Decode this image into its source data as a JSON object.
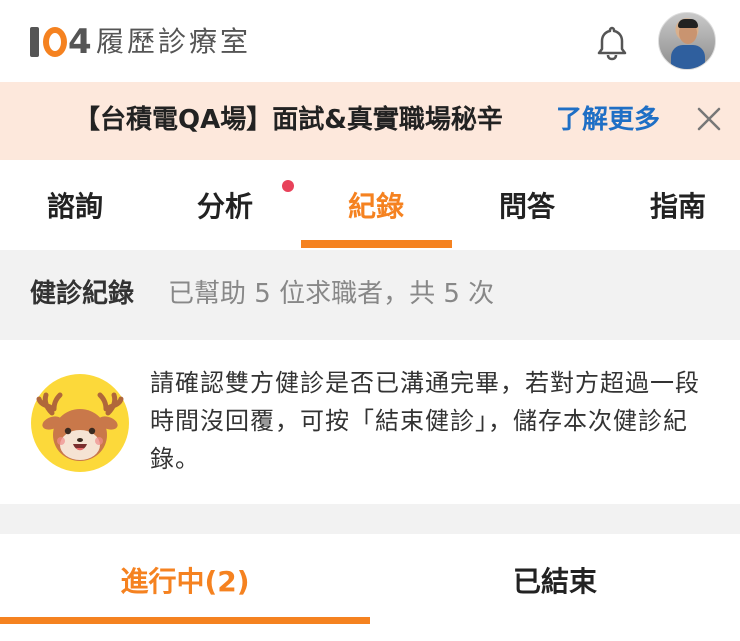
{
  "header": {
    "logo_text": "履歷診療室",
    "logo_mark": "104",
    "bell_icon": "bell-icon",
    "avatar_icon": "user-avatar"
  },
  "banner": {
    "text": "【台積電QA場】面試&真實職場秘辛",
    "link": "了解更多",
    "close_icon": "close-icon"
  },
  "tabs": [
    {
      "label": "諮詢"
    },
    {
      "label": "分析"
    },
    {
      "label": "紀錄"
    },
    {
      "label": "問答"
    },
    {
      "label": "指南"
    }
  ],
  "active_tab": "紀錄",
  "summary": {
    "title": "健診紀錄",
    "desc": "已幫助 5 位求職者，共 5 次"
  },
  "notice": {
    "text": "請確認雙方健診是否已溝通完畢，若對方超過一段時間沒回覆，可按「結束健診」，儲存本次健診紀錄。",
    "mascot_icon": "deer-mascot-icon"
  },
  "subtabs": [
    {
      "label": "進行中(2)"
    },
    {
      "label": "已結束"
    }
  ],
  "colors": {
    "accent": "#f58220",
    "banner_bg": "#fde8dc",
    "link": "#1f6fc5",
    "dot": "#e8425a"
  }
}
